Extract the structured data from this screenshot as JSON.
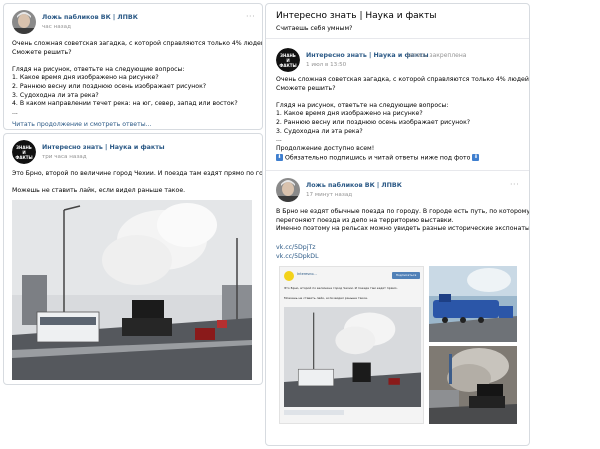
{
  "post1": {
    "author": "Ложь пабликов ВК | ЛПВК",
    "time": "час назад",
    "lines": [
      "Очень сложная советская загадка, с которой справляются только 4% людей.",
      "Сможете решить?",
      "",
      "Глядя на рисунок, ответьте на следующие вопросы:",
      "1. Какое время дня изображено на рисунке?",
      "2. Раннюю весну или позднюю осень изображает рисунок?",
      "3. Судоходна ли эта река?",
      "4. В каком направлении течет река: на юг, север, запад или восток?",
      "..."
    ],
    "more_link": "Читать продолжение и смотреть ответы..."
  },
  "post2": {
    "author": "Интересно знать | Наука и факты",
    "time": "три часа назад",
    "lines": [
      "Это Брно, второй по величине город Чехии. И поезда там ездят прямо по городу.",
      "",
      "Можешь не ставить лайк, если видел раньше такое."
    ],
    "avatar_text": [
      "ЗНАНЬ",
      "И",
      "ФАКТЫ"
    ]
  },
  "group_header": {
    "title": "Интересно знать | Наука и факты",
    "status": "Считаешь себя умным?"
  },
  "pinned_post": {
    "author": "Интересно знать | Наука и факты",
    "pinned_label": "запись закреплена",
    "time": "1 июл в 13:50",
    "lines": [
      "Очень сложная советская загадка, с которой справляются только 4% людей.",
      "Сможете решить?",
      "",
      "Глядя на рисунок, ответьте на следующие вопросы:",
      "1. Какое время дня изображено на рисунке?",
      "2. Раннюю весну или позднюю осень изображает рисунок?",
      "3. Судоходна ли эта река?",
      "...",
      "Продолжение доступно всем!"
    ],
    "promo_text": "Обязательно подпишись и читай ответы ниже под фото"
  },
  "post3": {
    "author": "Ложь пабликов ВК | ЛПВК",
    "time": "17 минут назад",
    "lines": [
      "В Брно не ездят обычные поезда по городу. В городе есть путь, по которому",
      "перегоняют поезда из депо на территорию выставки.",
      "Именно поэтому на рельсах можно увидеть разные исторические экспонаты."
    ],
    "links": [
      "vk.cc/5DpjTz",
      "vk.cc/5DpkDL"
    ],
    "embed": {
      "author": "Interesno...",
      "caption": "Это Брно, второй по величине город Чехии. И поезда там ездят прямо.",
      "caption2": "Можешь не ставить лайк, если видел раньше такое.",
      "button": "Подписаться"
    }
  }
}
